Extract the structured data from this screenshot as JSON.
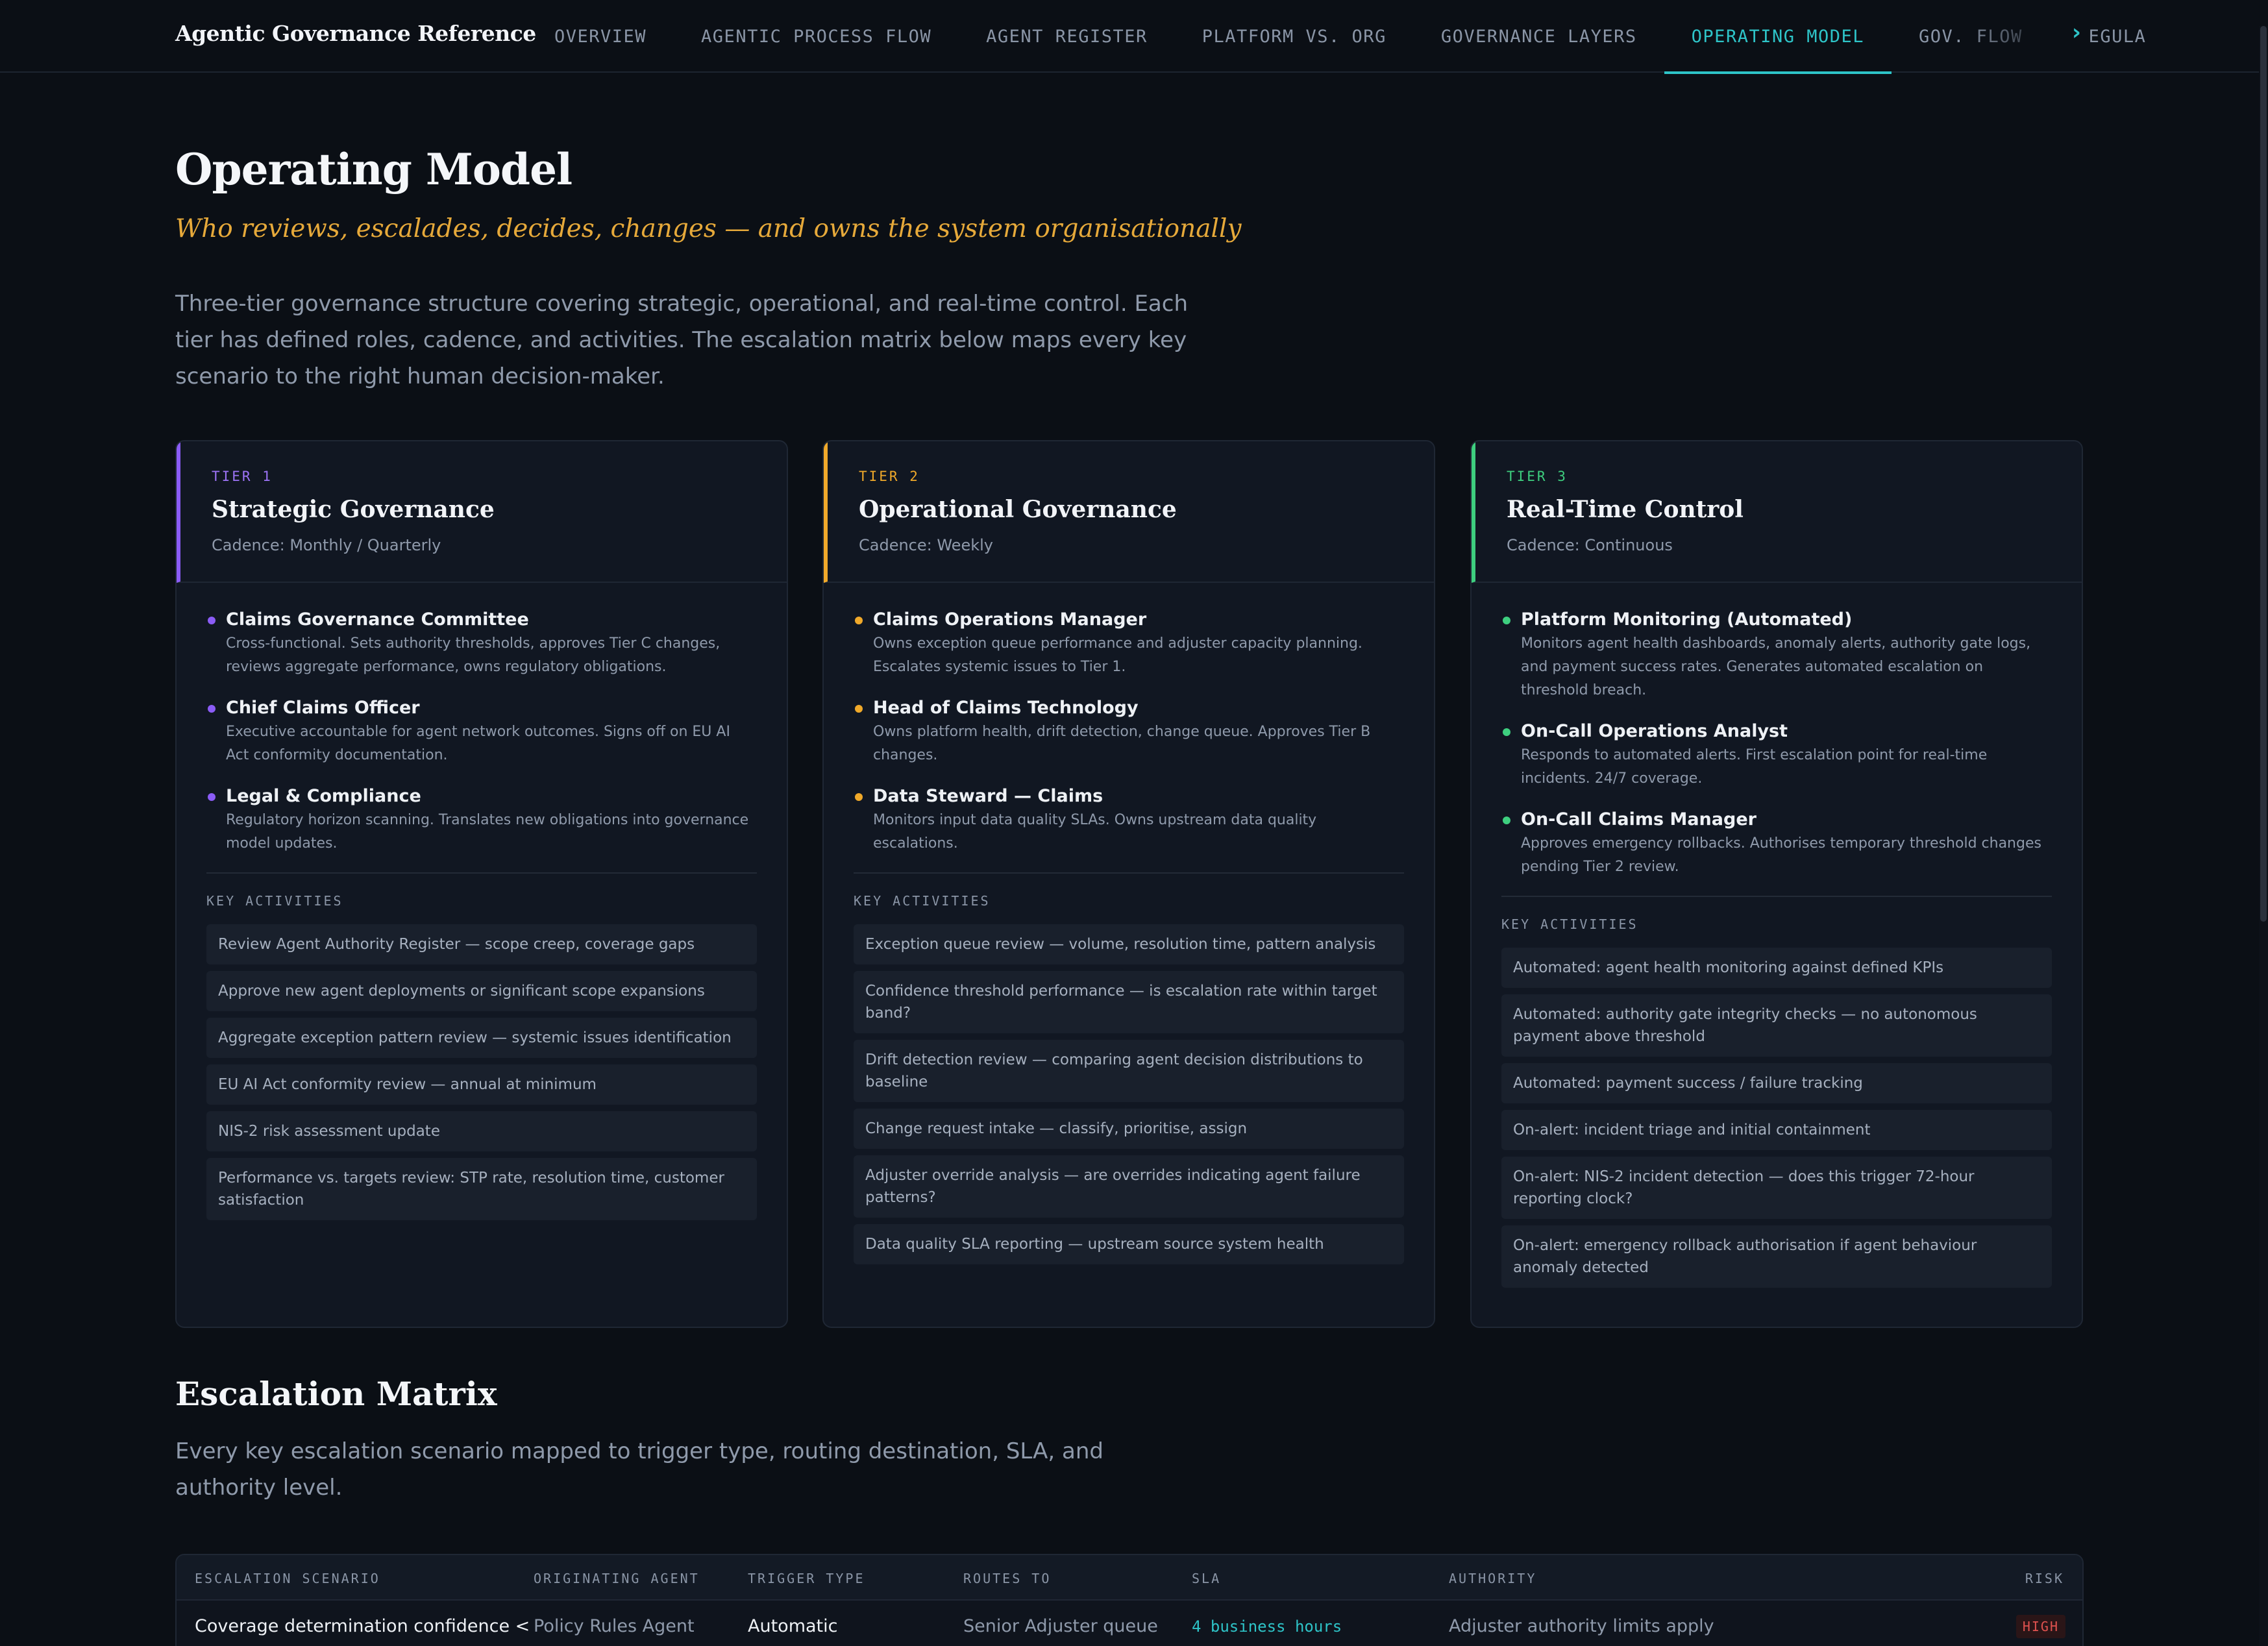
{
  "brand": "Agentic Governance Reference",
  "nav": {
    "tabs": [
      {
        "label": "OVERVIEW"
      },
      {
        "label": "AGENTIC PROCESS FLOW"
      },
      {
        "label": "AGENT REGISTER"
      },
      {
        "label": "PLATFORM VS. ORG"
      },
      {
        "label": "GOVERNANCE LAYERS"
      },
      {
        "label": "OPERATING MODEL",
        "active": true
      },
      {
        "label": "GOV. FLOW"
      },
      {
        "label": "REGULA"
      }
    ],
    "more_icon": "chevron-right-icon"
  },
  "page": {
    "title": "Operating Model",
    "subtitle": "Who reviews, escalades, decides, changes — and owns the system organisationally",
    "intro": "Three-tier governance structure covering strategic, operational, and real-time control. Each tier has defined roles, cadence, and activities. The escalation matrix below maps every key scenario to the right human decision-maker."
  },
  "colors": {
    "tier1": "#8b5cf6",
    "tier2": "#f0a92a",
    "tier3": "#3ecf7f",
    "accent": "#2ec4c8"
  },
  "tiers": [
    {
      "label": "TIER 1",
      "name": "Strategic Governance",
      "cadence": "Cadence: Monthly / Quarterly",
      "roles": [
        {
          "title": "Claims Governance Committee",
          "desc": "Cross-functional. Sets authority thresholds, approves Tier C changes, reviews aggregate performance, owns regulatory obligations."
        },
        {
          "title": "Chief Claims Officer",
          "desc": "Executive accountable for agent network outcomes. Signs off on EU AI Act conformity documentation."
        },
        {
          "title": "Legal & Compliance",
          "desc": "Regulatory horizon scanning. Translates new obligations into governance model updates."
        }
      ],
      "activities_label": "KEY ACTIVITIES",
      "activities": [
        "Review Agent Authority Register — scope creep, coverage gaps",
        "Approve new agent deployments or significant scope expansions",
        "Aggregate exception pattern review — systemic issues identification",
        "EU AI Act conformity review — annual at minimum",
        "NIS-2 risk assessment update",
        "Performance vs. targets review: STP rate, resolution time, customer satisfaction"
      ]
    },
    {
      "label": "TIER 2",
      "name": "Operational Governance",
      "cadence": "Cadence: Weekly",
      "roles": [
        {
          "title": "Claims Operations Manager",
          "desc": "Owns exception queue performance and adjuster capacity planning. Escalates systemic issues to Tier 1."
        },
        {
          "title": "Head of Claims Technology",
          "desc": "Owns platform health, drift detection, change queue. Approves Tier B changes."
        },
        {
          "title": "Data Steward — Claims",
          "desc": "Monitors input data quality SLAs. Owns upstream data quality escalations."
        }
      ],
      "activities_label": "KEY ACTIVITIES",
      "activities": [
        "Exception queue review — volume, resolution time, pattern analysis",
        "Confidence threshold performance — is escalation rate within target band?",
        "Drift detection review — comparing agent decision distributions to baseline",
        "Change request intake — classify, prioritise, assign",
        "Adjuster override analysis — are overrides indicating agent failure patterns?",
        "Data quality SLA reporting — upstream source system health"
      ]
    },
    {
      "label": "TIER 3",
      "name": "Real-Time Control",
      "cadence": "Cadence: Continuous",
      "roles": [
        {
          "title": "Platform Monitoring (Automated)",
          "desc": "Monitors agent health dashboards, anomaly alerts, authority gate logs, and payment success rates. Generates automated escalation on threshold breach."
        },
        {
          "title": "On-Call Operations Analyst",
          "desc": "Responds to automated alerts. First escalation point for real-time incidents. 24/7 coverage."
        },
        {
          "title": "On-Call Claims Manager",
          "desc": "Approves emergency rollbacks. Authorises temporary threshold changes pending Tier 2 review."
        }
      ],
      "activities_label": "KEY ACTIVITIES",
      "activities": [
        "Automated: agent health monitoring against defined KPIs",
        "Automated: authority gate integrity checks — no autonomous payment above threshold",
        "Automated: payment success / failure tracking",
        "On-alert: incident triage and initial containment",
        "On-alert: NIS-2 incident detection — does this trigger 72-hour reporting clock?",
        "On-alert: emergency rollback authorisation if agent behaviour anomaly detected"
      ]
    }
  ],
  "escalation": {
    "title": "Escalation Matrix",
    "intro": "Every key escalation scenario mapped to trigger type, routing destination, SLA, and authority level.",
    "columns": [
      "ESCALATION SCENARIO",
      "ORIGINATING AGENT",
      "TRIGGER TYPE",
      "ROUTES TO",
      "SLA",
      "AUTHORITY",
      "RISK"
    ],
    "rows": [
      {
        "scenario": "Coverage determination confidence <",
        "agent": "Policy Rules Agent",
        "trigger": "Automatic",
        "routes_to": "Senior Adjuster queue",
        "sla": "4 business hours",
        "authority": "Adjuster authority limits apply",
        "risk": "HIGH"
      }
    ]
  }
}
